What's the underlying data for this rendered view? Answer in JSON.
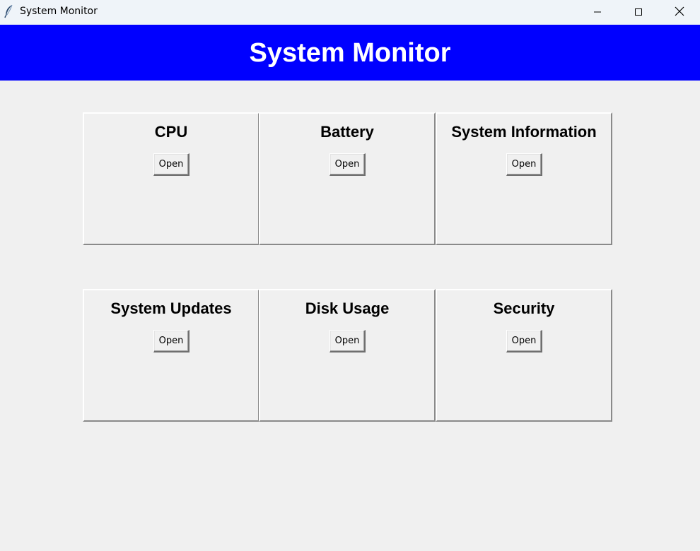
{
  "window": {
    "title": "System Monitor",
    "icon": "feather-icon",
    "controls": [
      "minimize-icon",
      "maximize-icon",
      "close-icon"
    ]
  },
  "header": {
    "title": "System Monitor",
    "background": "#0000ff",
    "color": "#ffffff"
  },
  "panels": [
    {
      "title": "CPU",
      "button": "Open"
    },
    {
      "title": "Battery",
      "button": "Open"
    },
    {
      "title": "System Information",
      "button": "Open"
    },
    {
      "title": "System Updates",
      "button": "Open"
    },
    {
      "title": "Disk Usage",
      "button": "Open"
    },
    {
      "title": "Security",
      "button": "Open"
    }
  ]
}
